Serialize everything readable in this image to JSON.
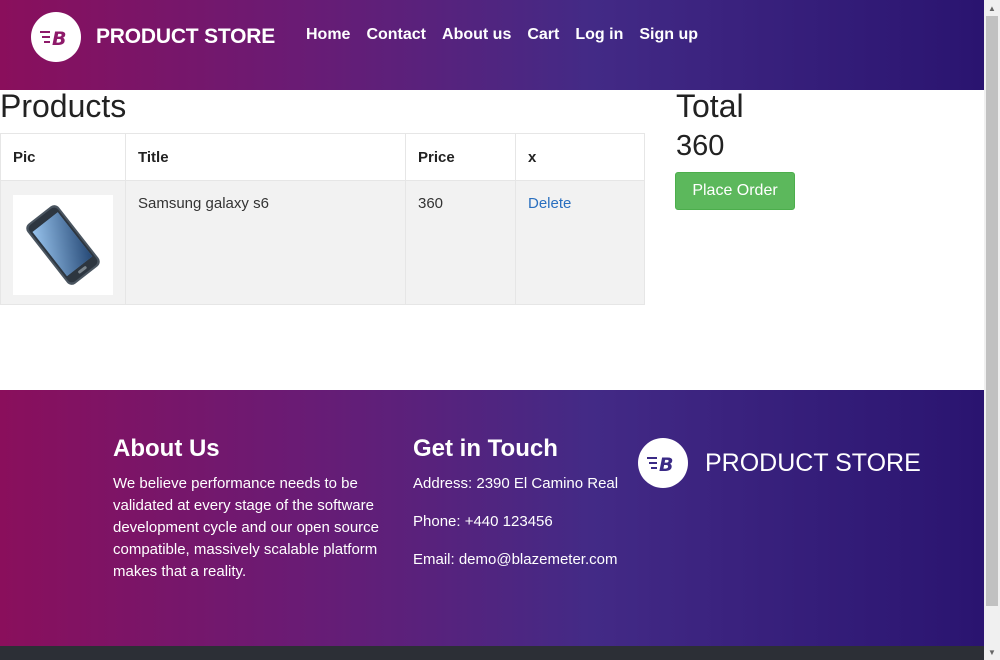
{
  "navbar": {
    "brand": "PRODUCT STORE",
    "links": [
      "Home",
      "Contact",
      "About us",
      "Cart",
      "Log in",
      "Sign up"
    ]
  },
  "products": {
    "title": "Products",
    "columns": [
      "Pic",
      "Title",
      "Price",
      "x"
    ],
    "rows": [
      {
        "title": "Samsung galaxy s6",
        "price": "360",
        "action": "Delete"
      }
    ]
  },
  "total": {
    "label": "Total",
    "value": "360",
    "button": "Place Order"
  },
  "footer": {
    "about_title": "About Us",
    "about_text": "We believe performance needs to be validated at every stage of the software development cycle and our open source compatible, massively scalable platform makes that a reality.",
    "touch_title": "Get in Touch",
    "address": "Address: 2390 El Camino Real",
    "phone": "Phone: +440 123456",
    "email": "Email: demo@blazemeter.com",
    "brand": "PRODUCT STORE"
  },
  "colors": {
    "accent_green": "#5cb85c",
    "link_blue": "#2a6fbf",
    "gradient_start": "#8a0f5c",
    "gradient_end": "#2a1470"
  },
  "icons": {
    "logo": "blazemeter-logo-icon"
  }
}
